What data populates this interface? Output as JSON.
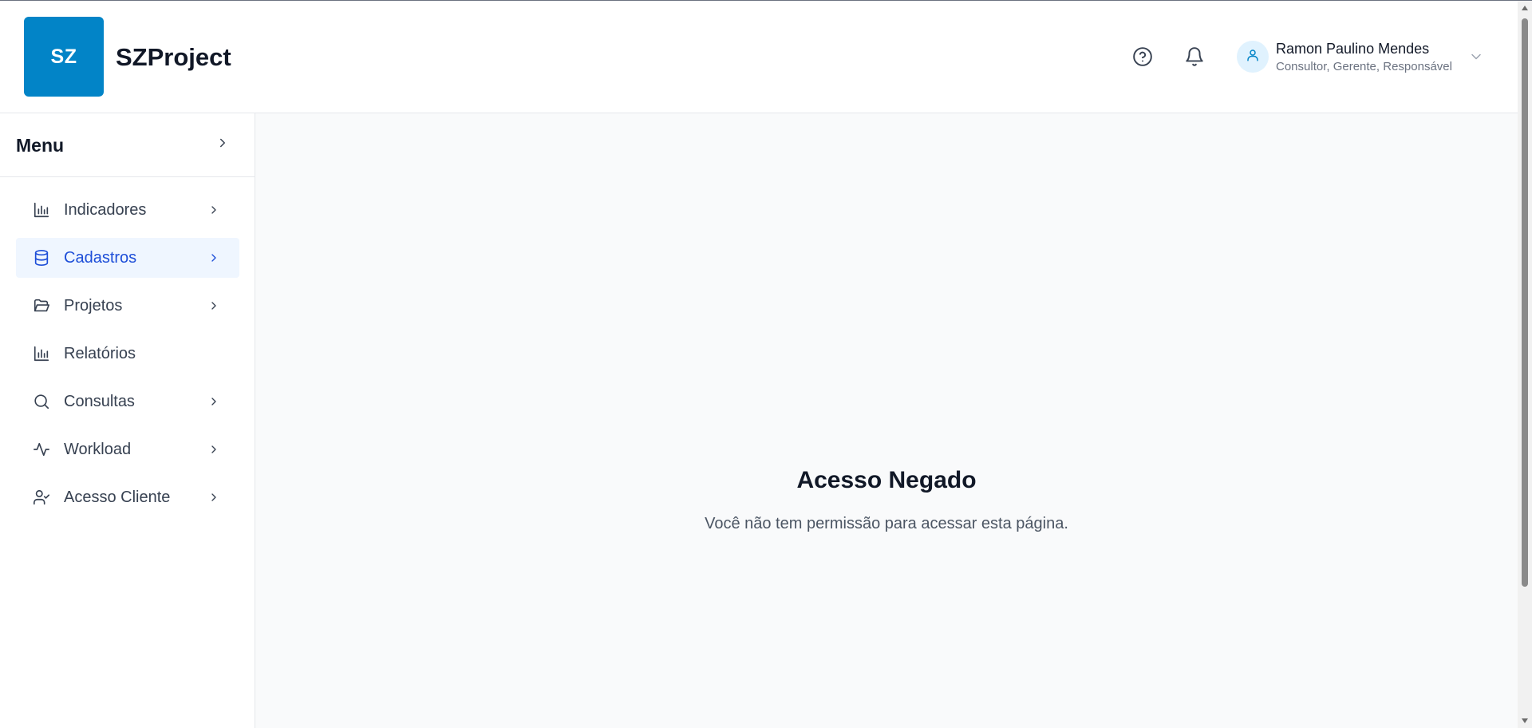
{
  "brand": {
    "logo_text": "SZ",
    "name": "SZProject",
    "color": "#0284c7"
  },
  "header": {
    "help_icon": "help-circle-icon",
    "notifications_icon": "bell-icon",
    "user": {
      "name": "Ramon Paulino Mendes",
      "roles": "Consultor, Gerente, Responsável",
      "avatar_icon": "user-icon",
      "dropdown_icon": "chevron-down-icon"
    }
  },
  "sidebar": {
    "title": "Menu",
    "toggle_icon": "chevron-right-icon",
    "items": [
      {
        "label": "Indicadores",
        "icon": "bar-chart-icon",
        "has_submenu": true,
        "active": false
      },
      {
        "label": "Cadastros",
        "icon": "database-icon",
        "has_submenu": true,
        "active": true
      },
      {
        "label": "Projetos",
        "icon": "folder-open-icon",
        "has_submenu": true,
        "active": false
      },
      {
        "label": "Relatórios",
        "icon": "bar-chart-icon",
        "has_submenu": false,
        "active": false
      },
      {
        "label": "Consultas",
        "icon": "search-icon",
        "has_submenu": true,
        "active": false
      },
      {
        "label": "Workload",
        "icon": "activity-icon",
        "has_submenu": true,
        "active": false
      },
      {
        "label": "Acesso Cliente",
        "icon": "user-check-icon",
        "has_submenu": true,
        "active": false
      }
    ]
  },
  "main": {
    "title": "Acesso Negado",
    "message": "Você não tem permissão para acessar esta página."
  },
  "colors": {
    "accent": "#0284c7",
    "active_text": "#1d4ed8",
    "active_bg": "#eff6ff",
    "main_bg": "#f9fafb"
  }
}
